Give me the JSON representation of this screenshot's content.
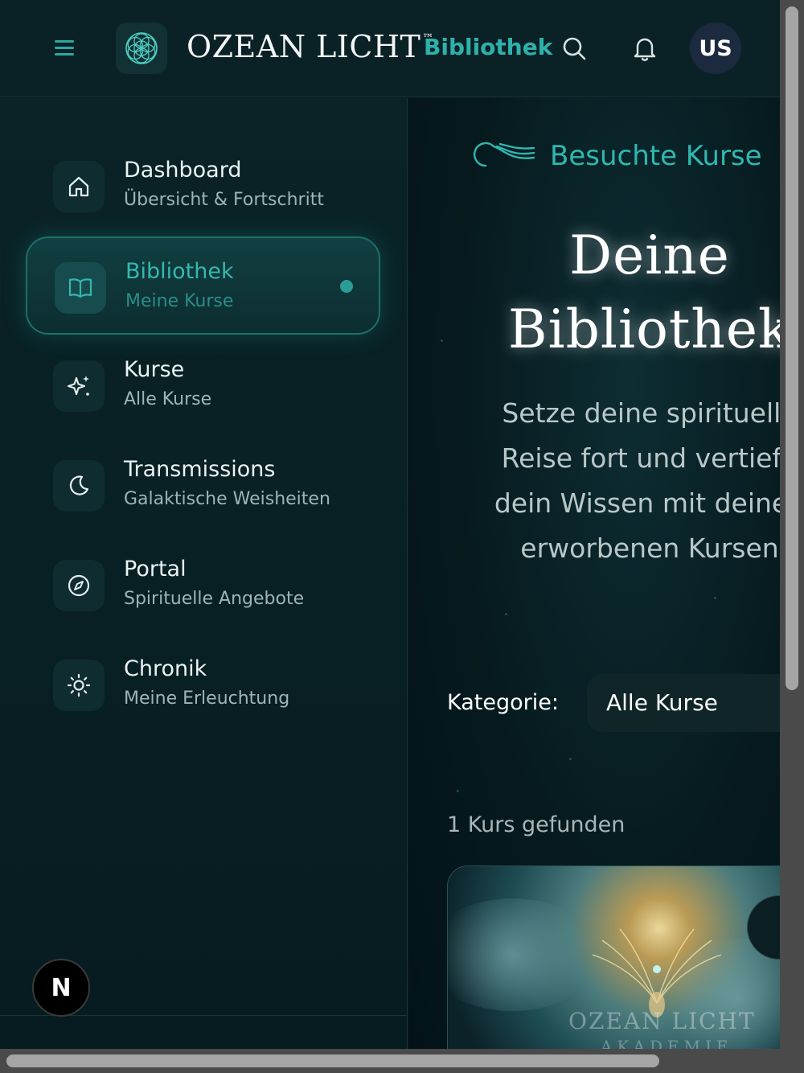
{
  "header": {
    "brand_name": "OZEAN LICHT",
    "brand_tm": "™",
    "current_section": "Bibliothek",
    "avatar_initials": "US",
    "menu_icon": "hamburger-menu-icon",
    "logo_icon": "flower-of-life-icon"
  },
  "sidebar": {
    "items": [
      {
        "title": "Dashboard",
        "subtitle": "Übersicht & Fortschritt",
        "icon": "home-icon",
        "active": false
      },
      {
        "title": "Bibliothek",
        "subtitle": "Meine Kurse",
        "icon": "book-icon",
        "active": true
      },
      {
        "title": "Kurse",
        "subtitle": "Alle Kurse",
        "icon": "sparkles-icon",
        "active": false
      },
      {
        "title": "Transmissions",
        "subtitle": "Galaktische Weisheiten",
        "icon": "moon-icon",
        "active": false
      },
      {
        "title": "Portal",
        "subtitle": "Spirituelle Angebote",
        "icon": "compass-icon",
        "active": false
      },
      {
        "title": "Chronik",
        "subtitle": "Meine Erleuchtung",
        "icon": "sun-icon",
        "active": false
      }
    ],
    "badge": "N"
  },
  "main": {
    "eyebrow": "Besuchte Kurse",
    "title": "Deine\nBibliothek",
    "description": "Setze deine spirituelle Reise fort und vertiefe dein Wissen mit deinen erworbenen Kursen",
    "filter_label": "Kategorie:",
    "filter_value": "Alle Kurse",
    "result_count": "1 Kurs gefunden",
    "course_watermark": "OZEAN LICHT",
    "course_watermark_sub": "AKADEMIE"
  },
  "colors": {
    "accent": "#2fb1ab",
    "background": "#061b1f",
    "sidebar_bg": "#0a2327",
    "active_border": "#1c6f6c"
  }
}
